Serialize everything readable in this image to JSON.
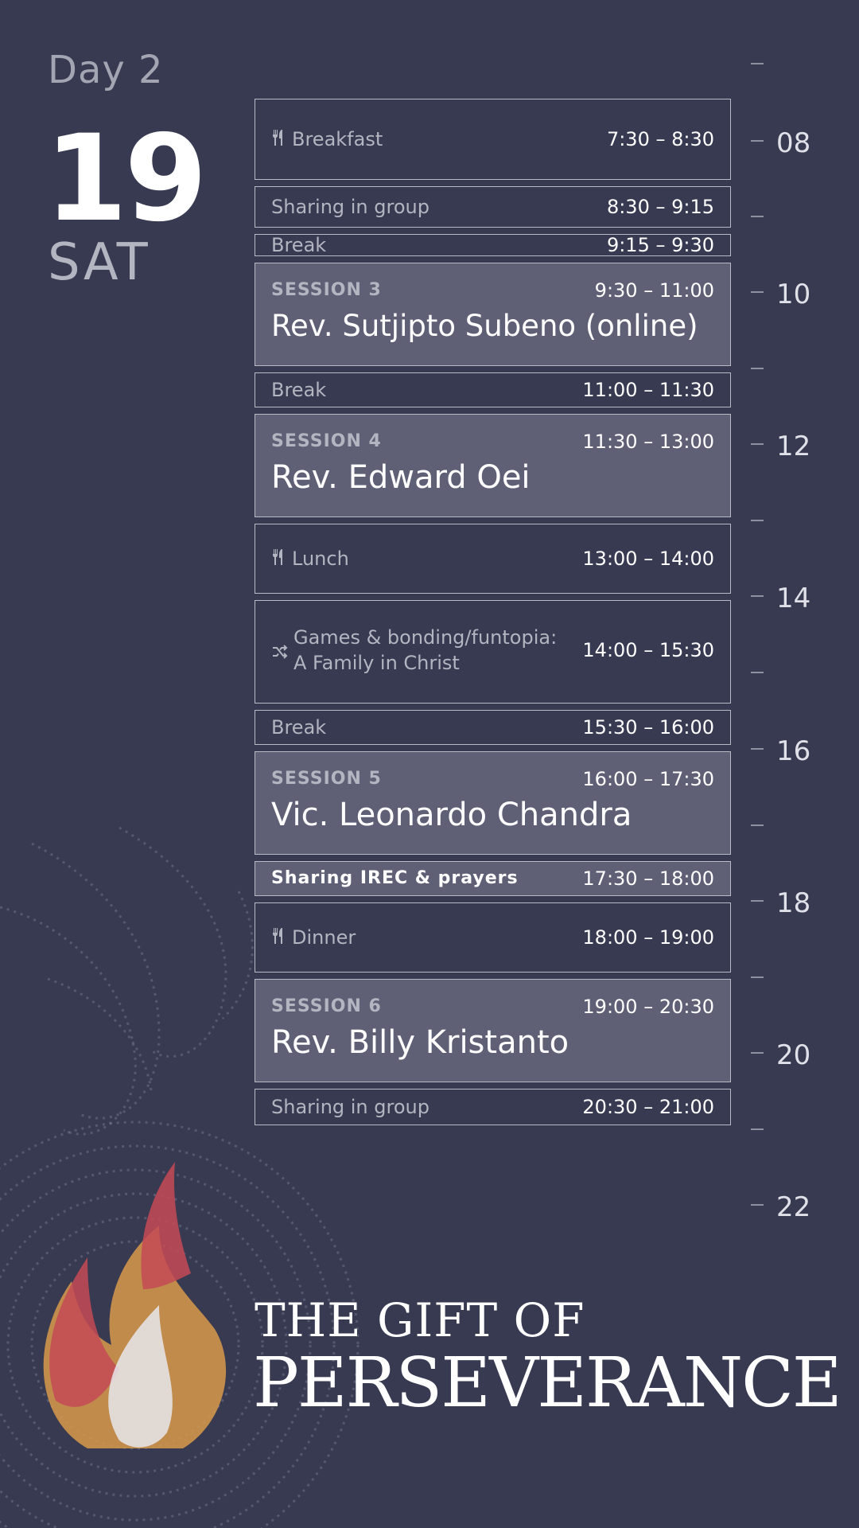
{
  "header": {
    "day_label": "Day 2",
    "date_number": "19",
    "weekday": "SAT"
  },
  "events": [
    {
      "id": "breakfast",
      "icon": "cutlery-icon",
      "name": "Breakfast",
      "time": "7:30 – 8:30"
    },
    {
      "id": "sharing1",
      "name": "Sharing in group",
      "time": "8:30 – 9:15"
    },
    {
      "id": "break1",
      "name": "Break",
      "time": "9:15 – 9:30"
    },
    {
      "id": "session3",
      "name": "SESSION 3",
      "speaker": "Rev. Sutjipto Subeno (online)",
      "time": "9:30 – 11:00"
    },
    {
      "id": "break2",
      "name": "Break",
      "time": "11:00 – 11:30"
    },
    {
      "id": "session4",
      "name": "SESSION 4",
      "speaker": "Rev. Edward Oei",
      "time": "11:30 – 13:00"
    },
    {
      "id": "lunch",
      "icon": "cutlery-icon",
      "name": "Lunch",
      "time": "13:00 – 14:00"
    },
    {
      "id": "games",
      "icon": "shuffle-icon",
      "name_line1": "Games & bonding/funtopia:",
      "name_line2": "A Family in Christ",
      "time": "14:00 – 15:30"
    },
    {
      "id": "break3",
      "name": "Break",
      "time": "15:30 – 16:00"
    },
    {
      "id": "session5",
      "name": "SESSION 5",
      "speaker": "Vic. Leonardo Chandra",
      "time": "16:00 – 17:30"
    },
    {
      "id": "sharing_irec",
      "name": "Sharing IREC & prayers",
      "time": "17:30 – 18:00"
    },
    {
      "id": "dinner",
      "icon": "cutlery-icon",
      "name": "Dinner",
      "time": "18:00 – 19:00"
    },
    {
      "id": "session6",
      "name": "SESSION 6",
      "speaker": "Rev. Billy Kristanto",
      "time": "19:00 – 20:30"
    },
    {
      "id": "sharing2",
      "name": "Sharing in group",
      "time": "20:30 – 21:00"
    }
  ],
  "axis": {
    "labels": [
      "08",
      "10",
      "12",
      "14",
      "16",
      "18",
      "20",
      "22"
    ]
  },
  "branding": {
    "title_line1": "THE GIFT OF",
    "title_line2": "PERSEVERANCE"
  },
  "colors": {
    "background": "#373a51",
    "session_fill": "#5f6075",
    "flame_orange": "#d89a4a",
    "flame_red": "#c44a55"
  }
}
